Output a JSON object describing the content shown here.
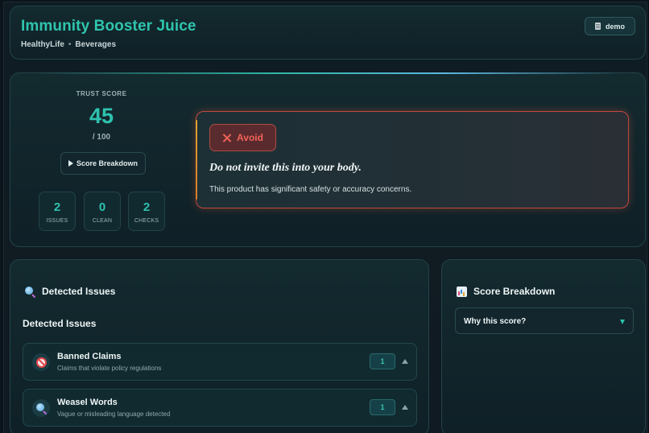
{
  "header": {
    "title": "Immunity Booster Juice",
    "brand": "HealthyLife",
    "separator": "•",
    "category": "Beverages",
    "demo_label": "demo"
  },
  "trust": {
    "label": "TRUST SCORE",
    "score": "45",
    "max": "/ 100",
    "breakdown_button": "Score Breakdown",
    "stats": [
      {
        "value": "2",
        "label": "ISSUES"
      },
      {
        "value": "0",
        "label": "CLEAN"
      },
      {
        "value": "2",
        "label": "CHECKS"
      }
    ]
  },
  "verdict": {
    "badge": "Avoid",
    "headline": "Do not invite this into your body.",
    "description": "This product has significant safety or accuracy concerns."
  },
  "issues_panel": {
    "title": "Detected Issues",
    "subtitle": "Detected Issues",
    "items": [
      {
        "icon": "ban-icon",
        "title": "Banned Claims",
        "description": "Claims that violate policy regulations",
        "count": "1"
      },
      {
        "icon": "magnifier-icon",
        "title": "Weasel Words",
        "description": "Vague or misleading language detected",
        "count": "1"
      }
    ]
  },
  "breakdown_panel": {
    "title": "Score Breakdown",
    "select_label": "Why this score?"
  },
  "colors": {
    "accent": "#2ec2ae",
    "danger": "#f0635a",
    "background": "#0b141b"
  }
}
